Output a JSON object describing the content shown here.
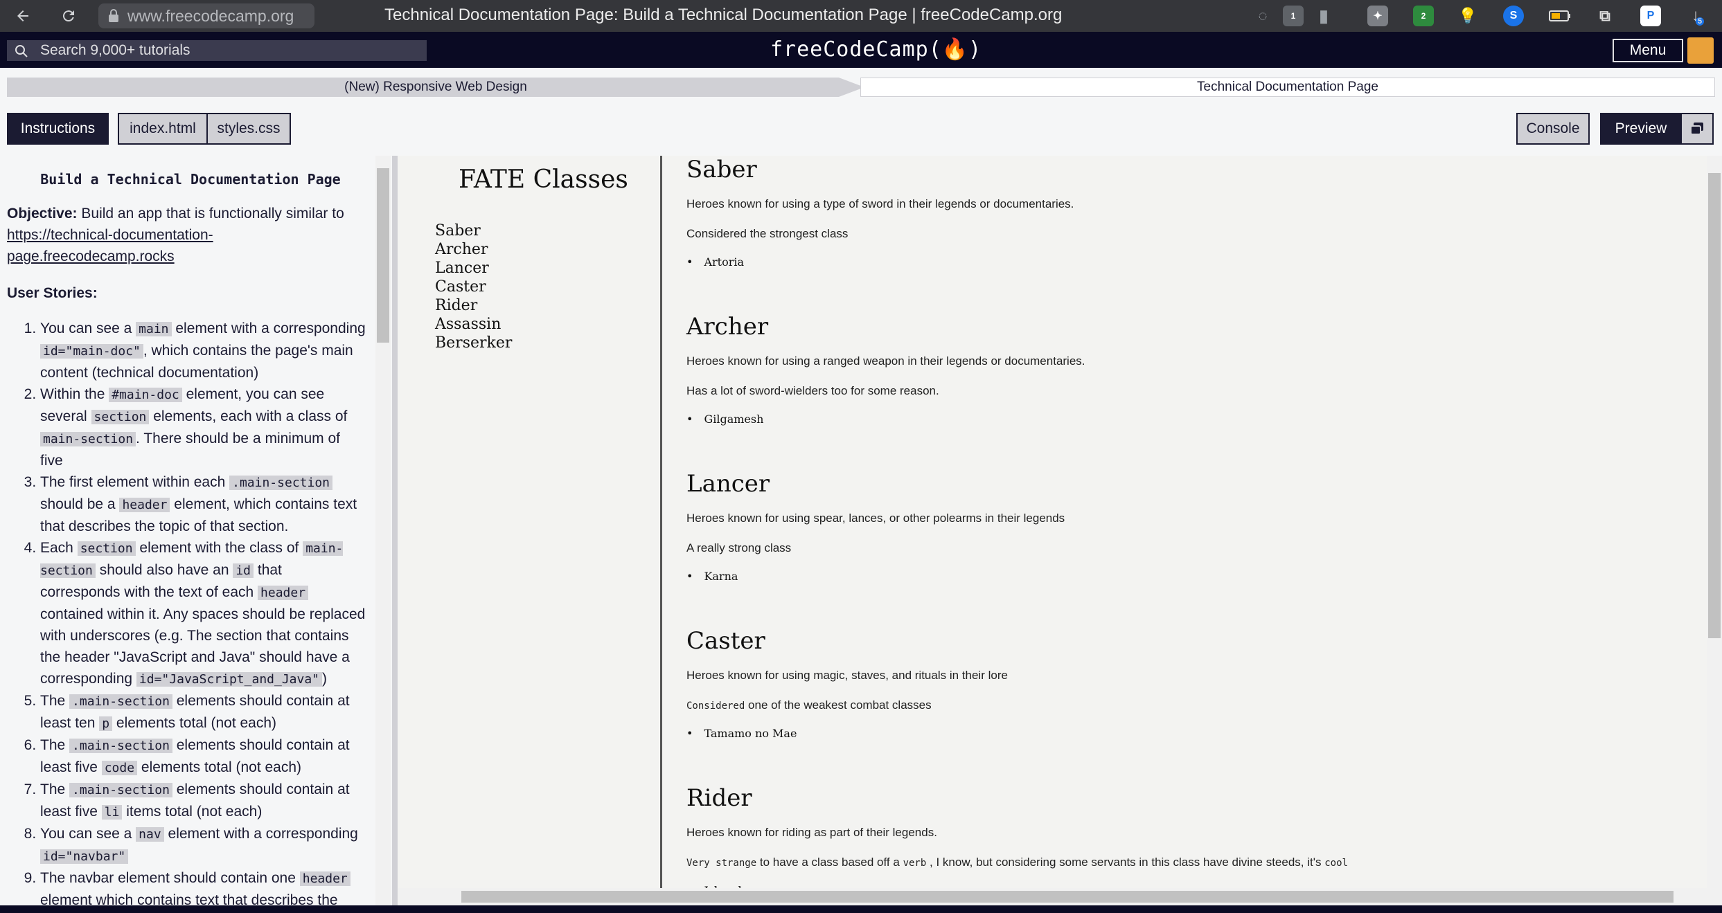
{
  "browser": {
    "url": "www.freecodecamp.org",
    "title": "Technical Documentation Page: Build a Technical Documentation Page | freeCodeCamp.org",
    "badges": [
      "1",
      "2",
      "5"
    ]
  },
  "fcc_nav": {
    "search_placeholder": "Search 9,000+ tutorials",
    "brand": "freeCodeCamp(🔥)",
    "menu_label": "Menu"
  },
  "breadcrumb": {
    "course": "(New) Responsive Web Design",
    "project": "Technical Documentation Page"
  },
  "tabs": {
    "instructions": "Instructions",
    "index_html": "index.html",
    "styles_css": "styles.css",
    "console": "Console",
    "preview": "Preview"
  },
  "instructions": {
    "heading": "Build a Technical Documentation Page",
    "objective_label": "Objective:",
    "objective_text": "Build an app that is functionally similar to",
    "objective_link": "https://technical-documentation-page.freecodecamp.rocks",
    "user_stories_label": "User Stories:",
    "stories": [
      {
        "parts": [
          "You can see a ",
          "main",
          " element with a corresponding ",
          "id=\"main-doc\"",
          ", which contains the page's main content (technical documentation)"
        ]
      },
      {
        "parts": [
          "Within the ",
          "#main-doc",
          " element, you can see several ",
          "section",
          " elements, each with a class of ",
          "main-section",
          ". There should be a minimum of five"
        ]
      },
      {
        "parts": [
          "The first element within each ",
          ".main-section",
          " should be a ",
          "header",
          " element, which contains text that describes the topic of that section."
        ]
      },
      {
        "parts": [
          "Each ",
          "section",
          " element with the class of ",
          "main-section",
          " should also have an ",
          "id",
          " that corresponds with the text of each ",
          "header",
          " contained within it. Any spaces should be replaced with underscores (e.g. The section that contains the header \"JavaScript and Java\" should have a corresponding ",
          "id=\"JavaScript_and_Java\"",
          ")"
        ]
      },
      {
        "parts": [
          "The ",
          ".main-section",
          " elements should contain at least ten ",
          "p",
          " elements total (not each)"
        ]
      },
      {
        "parts": [
          "The ",
          ".main-section",
          " elements should contain at least five ",
          "code",
          " elements total (not each)"
        ]
      },
      {
        "parts": [
          "The ",
          ".main-section",
          " elements should contain at least five ",
          "li",
          " items total (not each)"
        ]
      },
      {
        "parts": [
          "You can see a ",
          "nav",
          " element with a corresponding ",
          "id=\"navbar\"",
          ""
        ]
      },
      {
        "parts": [
          "The navbar element should contain one ",
          "header",
          " element which contains text that describes the"
        ]
      }
    ]
  },
  "preview": {
    "nav_title": "FATE Classes",
    "nav_links": [
      "Saber",
      "Archer",
      "Lancer",
      "Caster",
      "Rider",
      "Assassin",
      "Berserker"
    ],
    "sections": [
      {
        "title": "Saber",
        "p1": "Heroes known for using a type of sword in their legends or documentaries.",
        "p2": "Considered the strongest class",
        "item": "Artoria"
      },
      {
        "title": "Archer",
        "p1": "Heroes known for using a ranged weapon in their legends or documentaries.",
        "p2": "Has a lot of sword-wielders too for some reason.",
        "item": "Gilgamesh"
      },
      {
        "title": "Lancer",
        "p1": "Heroes known for using spear, lances, or other polearms in their legends",
        "p2": "A really strong class",
        "item": "Karna"
      },
      {
        "title": "Caster",
        "p1": "Heroes known for using magic, staves, and rituals in their lore",
        "p2_code": "Considered",
        "p2": "one of the weakest combat classes",
        "item": "Tamamo no Mae"
      },
      {
        "title": "Rider",
        "p1": "Heroes known for riding as part of their legends.",
        "p2_code1": "Very strange",
        "p2a": "to have a class based off a",
        "p2_code2": "verb",
        "p2b": ", I know, but considering some servants in this class have divine steeds, it's",
        "p2_code3": "cool",
        "item": "Iskandar"
      }
    ]
  }
}
